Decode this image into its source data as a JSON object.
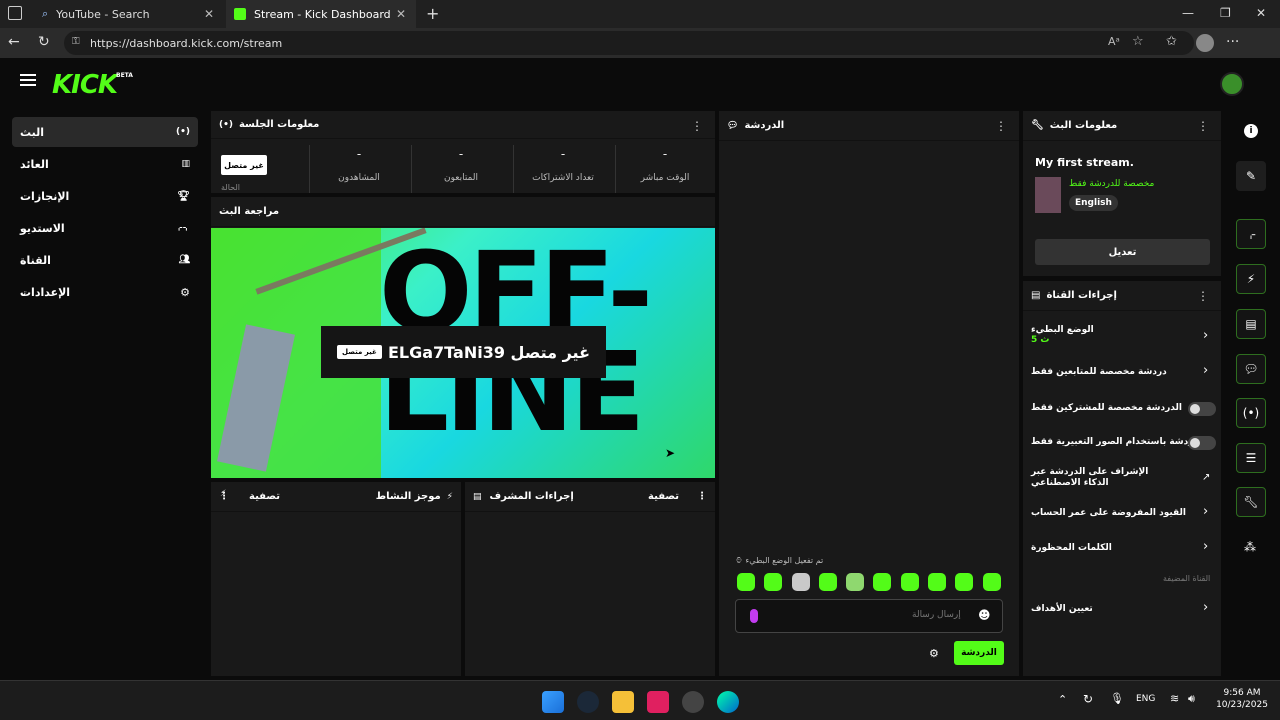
{
  "browser": {
    "tabs": [
      {
        "label": "YouTube - Search"
      },
      {
        "label": "Stream - Kick Dashboard"
      }
    ],
    "url": "https://dashboard.kick.com/stream"
  },
  "app": {
    "logo": "KICK",
    "logo_badge": "BETA"
  },
  "sidebar": {
    "items": [
      {
        "label": "البث",
        "icon": "broadcast-icon"
      },
      {
        "label": "العائد",
        "icon": "revenue-icon"
      },
      {
        "label": "الإنجازات",
        "icon": "trophy-icon"
      },
      {
        "label": "الاستديو",
        "icon": "studio-icon"
      },
      {
        "label": "القناة",
        "icon": "channel-icon"
      },
      {
        "label": "الإعدادات",
        "icon": "gear-icon"
      }
    ]
  },
  "session": {
    "title": "معلومات الجلسة",
    "offline_badge": "غير متصل",
    "offline_sub": "الحالة",
    "stats": [
      {
        "value": "-",
        "label": "المشاهدون"
      },
      {
        "value": "-",
        "label": "المتابعون"
      },
      {
        "value": "-",
        "label": "تعداد الاشتراكات"
      },
      {
        "value": "-",
        "label": "الوقت مباشر"
      }
    ]
  },
  "preview": {
    "title": "مراجعة البث",
    "overlay_text": "ELGa7TaNi39 غير متصل",
    "overlay_badge": "غير متصل",
    "offline_art": "OFF-LINE"
  },
  "activity": {
    "title": "موجز النشاط",
    "filter": "تصفية"
  },
  "mod": {
    "title": "إجراءات المشرف",
    "filter": "تصفية"
  },
  "chat": {
    "title": "الدردشة",
    "slow_notice": "تم تفعيل الوضع البطيء",
    "input_placeholder": "إرسال رسالة",
    "send_label": "الدردشة"
  },
  "stream_info": {
    "title": "معلومات البث",
    "stream_title": "My first stream.",
    "category": "مخصصة للدردشة فقط",
    "language": "English",
    "edit_label": "تعديل"
  },
  "channel_actions": {
    "title": "إجراءات القناة",
    "slow_mode": "الوضع البطيء",
    "slow_value": "5 ث",
    "followers_only": "دردشة مخصصة للمتابعين فقط",
    "subs_only": "الدردشة مخصصة للمشتركين فقط",
    "emotes_only": "الدردشة باستخدام الصور التعبيرية فقط",
    "ai_moderation": "الإشراف على الدردشة عبر الذكاء الاصطناعي",
    "account_age": "القيود المفروضة على عمر الحساب",
    "banned_words": "الكلمات المحظورة",
    "section_hosted": "القناة المضيفة",
    "goals": "تعيين الأهداف"
  },
  "taskbar": {
    "lang": "ENG",
    "time": "9:56 AM",
    "date": "10/23/2025"
  },
  "colors": {
    "accent": "#53fc18",
    "panel": "#191919",
    "bg": "#0b0b0b"
  }
}
